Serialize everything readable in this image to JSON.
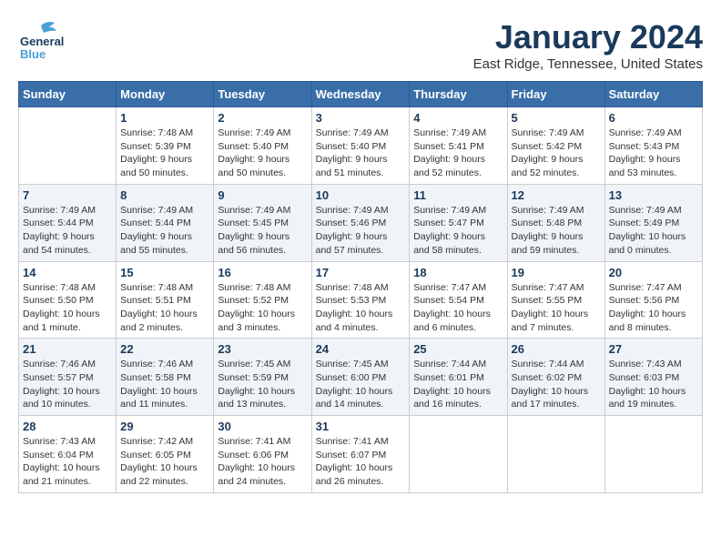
{
  "header": {
    "logo_general": "General",
    "logo_blue": "Blue",
    "month_title": "January 2024",
    "location": "East Ridge, Tennessee, United States"
  },
  "days_of_week": [
    "Sunday",
    "Monday",
    "Tuesday",
    "Wednesday",
    "Thursday",
    "Friday",
    "Saturday"
  ],
  "weeks": [
    [
      {
        "day": "",
        "sunrise": "",
        "sunset": "",
        "daylight": ""
      },
      {
        "day": "1",
        "sunrise": "Sunrise: 7:48 AM",
        "sunset": "Sunset: 5:39 PM",
        "daylight": "Daylight: 9 hours and 50 minutes."
      },
      {
        "day": "2",
        "sunrise": "Sunrise: 7:49 AM",
        "sunset": "Sunset: 5:40 PM",
        "daylight": "Daylight: 9 hours and 50 minutes."
      },
      {
        "day": "3",
        "sunrise": "Sunrise: 7:49 AM",
        "sunset": "Sunset: 5:40 PM",
        "daylight": "Daylight: 9 hours and 51 minutes."
      },
      {
        "day": "4",
        "sunrise": "Sunrise: 7:49 AM",
        "sunset": "Sunset: 5:41 PM",
        "daylight": "Daylight: 9 hours and 52 minutes."
      },
      {
        "day": "5",
        "sunrise": "Sunrise: 7:49 AM",
        "sunset": "Sunset: 5:42 PM",
        "daylight": "Daylight: 9 hours and 52 minutes."
      },
      {
        "day": "6",
        "sunrise": "Sunrise: 7:49 AM",
        "sunset": "Sunset: 5:43 PM",
        "daylight": "Daylight: 9 hours and 53 minutes."
      }
    ],
    [
      {
        "day": "7",
        "sunrise": "Sunrise: 7:49 AM",
        "sunset": "Sunset: 5:44 PM",
        "daylight": "Daylight: 9 hours and 54 minutes."
      },
      {
        "day": "8",
        "sunrise": "Sunrise: 7:49 AM",
        "sunset": "Sunset: 5:44 PM",
        "daylight": "Daylight: 9 hours and 55 minutes."
      },
      {
        "day": "9",
        "sunrise": "Sunrise: 7:49 AM",
        "sunset": "Sunset: 5:45 PM",
        "daylight": "Daylight: 9 hours and 56 minutes."
      },
      {
        "day": "10",
        "sunrise": "Sunrise: 7:49 AM",
        "sunset": "Sunset: 5:46 PM",
        "daylight": "Daylight: 9 hours and 57 minutes."
      },
      {
        "day": "11",
        "sunrise": "Sunrise: 7:49 AM",
        "sunset": "Sunset: 5:47 PM",
        "daylight": "Daylight: 9 hours and 58 minutes."
      },
      {
        "day": "12",
        "sunrise": "Sunrise: 7:49 AM",
        "sunset": "Sunset: 5:48 PM",
        "daylight": "Daylight: 9 hours and 59 minutes."
      },
      {
        "day": "13",
        "sunrise": "Sunrise: 7:49 AM",
        "sunset": "Sunset: 5:49 PM",
        "daylight": "Daylight: 10 hours and 0 minutes."
      }
    ],
    [
      {
        "day": "14",
        "sunrise": "Sunrise: 7:48 AM",
        "sunset": "Sunset: 5:50 PM",
        "daylight": "Daylight: 10 hours and 1 minute."
      },
      {
        "day": "15",
        "sunrise": "Sunrise: 7:48 AM",
        "sunset": "Sunset: 5:51 PM",
        "daylight": "Daylight: 10 hours and 2 minutes."
      },
      {
        "day": "16",
        "sunrise": "Sunrise: 7:48 AM",
        "sunset": "Sunset: 5:52 PM",
        "daylight": "Daylight: 10 hours and 3 minutes."
      },
      {
        "day": "17",
        "sunrise": "Sunrise: 7:48 AM",
        "sunset": "Sunset: 5:53 PM",
        "daylight": "Daylight: 10 hours and 4 minutes."
      },
      {
        "day": "18",
        "sunrise": "Sunrise: 7:47 AM",
        "sunset": "Sunset: 5:54 PM",
        "daylight": "Daylight: 10 hours and 6 minutes."
      },
      {
        "day": "19",
        "sunrise": "Sunrise: 7:47 AM",
        "sunset": "Sunset: 5:55 PM",
        "daylight": "Daylight: 10 hours and 7 minutes."
      },
      {
        "day": "20",
        "sunrise": "Sunrise: 7:47 AM",
        "sunset": "Sunset: 5:56 PM",
        "daylight": "Daylight: 10 hours and 8 minutes."
      }
    ],
    [
      {
        "day": "21",
        "sunrise": "Sunrise: 7:46 AM",
        "sunset": "Sunset: 5:57 PM",
        "daylight": "Daylight: 10 hours and 10 minutes."
      },
      {
        "day": "22",
        "sunrise": "Sunrise: 7:46 AM",
        "sunset": "Sunset: 5:58 PM",
        "daylight": "Daylight: 10 hours and 11 minutes."
      },
      {
        "day": "23",
        "sunrise": "Sunrise: 7:45 AM",
        "sunset": "Sunset: 5:59 PM",
        "daylight": "Daylight: 10 hours and 13 minutes."
      },
      {
        "day": "24",
        "sunrise": "Sunrise: 7:45 AM",
        "sunset": "Sunset: 6:00 PM",
        "daylight": "Daylight: 10 hours and 14 minutes."
      },
      {
        "day": "25",
        "sunrise": "Sunrise: 7:44 AM",
        "sunset": "Sunset: 6:01 PM",
        "daylight": "Daylight: 10 hours and 16 minutes."
      },
      {
        "day": "26",
        "sunrise": "Sunrise: 7:44 AM",
        "sunset": "Sunset: 6:02 PM",
        "daylight": "Daylight: 10 hours and 17 minutes."
      },
      {
        "day": "27",
        "sunrise": "Sunrise: 7:43 AM",
        "sunset": "Sunset: 6:03 PM",
        "daylight": "Daylight: 10 hours and 19 minutes."
      }
    ],
    [
      {
        "day": "28",
        "sunrise": "Sunrise: 7:43 AM",
        "sunset": "Sunset: 6:04 PM",
        "daylight": "Daylight: 10 hours and 21 minutes."
      },
      {
        "day": "29",
        "sunrise": "Sunrise: 7:42 AM",
        "sunset": "Sunset: 6:05 PM",
        "daylight": "Daylight: 10 hours and 22 minutes."
      },
      {
        "day": "30",
        "sunrise": "Sunrise: 7:41 AM",
        "sunset": "Sunset: 6:06 PM",
        "daylight": "Daylight: 10 hours and 24 minutes."
      },
      {
        "day": "31",
        "sunrise": "Sunrise: 7:41 AM",
        "sunset": "Sunset: 6:07 PM",
        "daylight": "Daylight: 10 hours and 26 minutes."
      },
      {
        "day": "",
        "sunrise": "",
        "sunset": "",
        "daylight": ""
      },
      {
        "day": "",
        "sunrise": "",
        "sunset": "",
        "daylight": ""
      },
      {
        "day": "",
        "sunrise": "",
        "sunset": "",
        "daylight": ""
      }
    ]
  ]
}
